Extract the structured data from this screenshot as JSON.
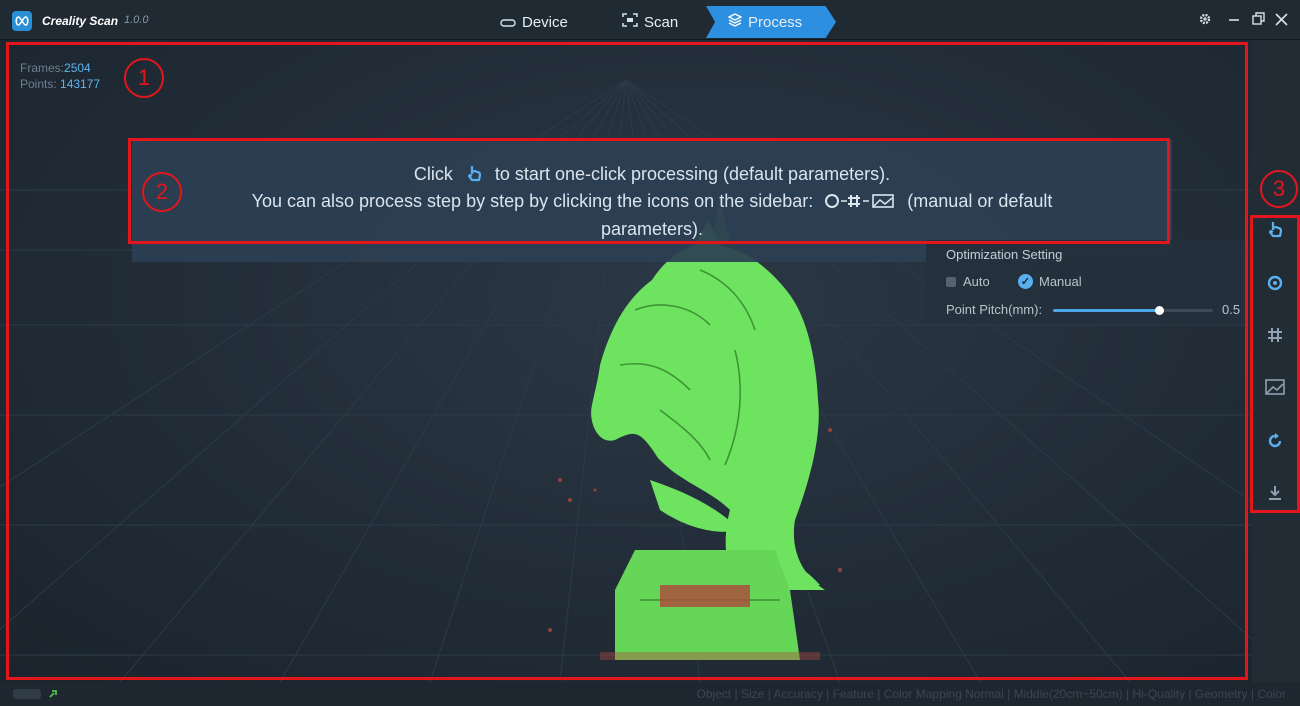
{
  "app": {
    "title": "Creality Scan",
    "version": "1.0.0"
  },
  "tabs": [
    {
      "label": "Device",
      "icon": "device-icon"
    },
    {
      "label": "Scan",
      "icon": "scan-icon"
    },
    {
      "label": "Process",
      "icon": "layers-icon",
      "active": true
    }
  ],
  "window_controls": [
    "settings-icon",
    "minimize-icon",
    "restore-icon",
    "close-icon"
  ],
  "stats": {
    "frames_label": "Frames:",
    "frames_value": "2504",
    "points_label": "Points:",
    "points_value": "143177"
  },
  "callouts": [
    "1",
    "2",
    "3"
  ],
  "tip": {
    "line1_before": "Click",
    "line1_after": "to start one-click processing (default parameters).",
    "line2_before": "You can also process step by step by clicking the icons on the sidebar:",
    "line2_after": "(manual or default parameters)."
  },
  "optimization": {
    "title": "Optimization Setting",
    "auto_label": "Auto",
    "manual_label": "Manual",
    "manual_selected": true,
    "pitch_label": "Point Pitch(mm):",
    "pitch_value": "0.5",
    "pitch_fraction": 0.66
  },
  "sidebar": [
    "one-click-process-icon",
    "point-cloud-icon",
    "mesh-icon",
    "texture-icon",
    "reset-icon",
    "export-icon"
  ],
  "statusbar": {
    "text": "Object | Size | Accuracy | Feature | Color Mapping    Normal | Middle(20cm~50cm) | Hi-Quality | Geometry | Color"
  },
  "colors": {
    "accent": "#2d8fe0",
    "model": "#6ee35f",
    "annotation": "#e5161b"
  }
}
